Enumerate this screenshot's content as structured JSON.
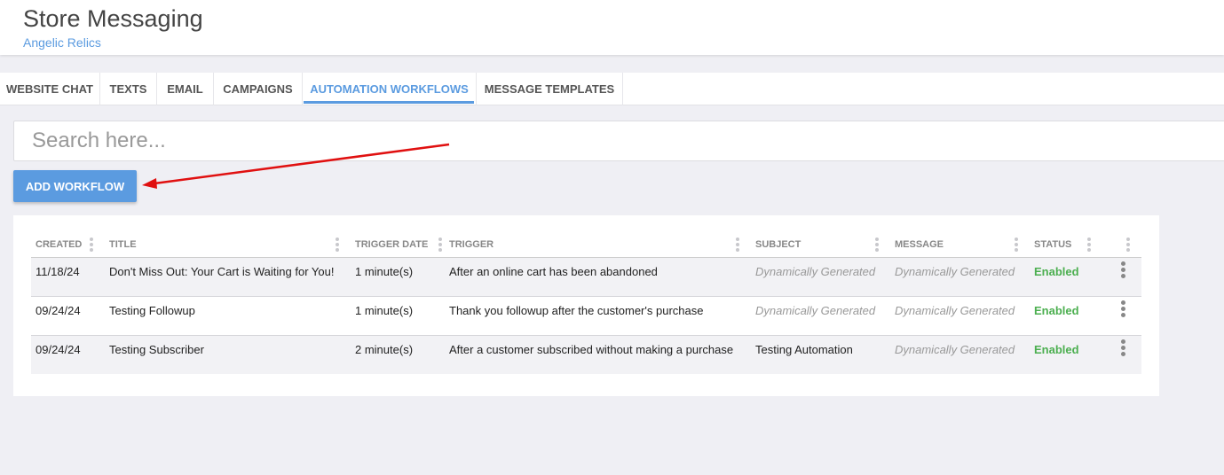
{
  "header": {
    "title": "Store Messaging",
    "store": "Angelic Relics"
  },
  "tabs": [
    {
      "label": "WEBSITE CHAT"
    },
    {
      "label": "TEXTS"
    },
    {
      "label": "EMAIL"
    },
    {
      "label": "CAMPAIGNS"
    },
    {
      "label": "AUTOMATION WORKFLOWS",
      "active": true
    },
    {
      "label": "MESSAGE TEMPLATES"
    }
  ],
  "search": {
    "placeholder": "Search here...",
    "value": ""
  },
  "add_button": {
    "label": "ADD WORKFLOW"
  },
  "annotation": {
    "arrow_color": "#e01010"
  },
  "table": {
    "columns": [
      "CREATED",
      "TITLE",
      "TRIGGER DATE",
      "TRIGGER",
      "SUBJECT",
      "MESSAGE",
      "STATUS",
      ""
    ],
    "rows": [
      {
        "created": "11/18/24",
        "title": "Don't Miss Out: Your Cart is Waiting for You!",
        "trigger_date": "1 minute(s)",
        "trigger": "After an online cart has been abandoned",
        "subject": "Dynamically Generated",
        "message": "Dynamically Generated",
        "status": "Enabled"
      },
      {
        "created": "09/24/24",
        "title": "Testing Followup",
        "trigger_date": "1 minute(s)",
        "trigger": "Thank you followup after the customer's purchase",
        "subject": "Dynamically Generated",
        "message": "Dynamically Generated",
        "status": "Enabled"
      },
      {
        "created": "09/24/24",
        "title": "Testing Subscriber",
        "trigger_date": "2 minute(s)",
        "trigger": "After a customer subscribed without making a purchase",
        "subject": "Testing Automation",
        "message": "Dynamically Generated",
        "status": "Enabled"
      }
    ]
  },
  "colors": {
    "accent": "#5b9be0",
    "enabled": "#4caf50",
    "background": "#efeff4"
  }
}
